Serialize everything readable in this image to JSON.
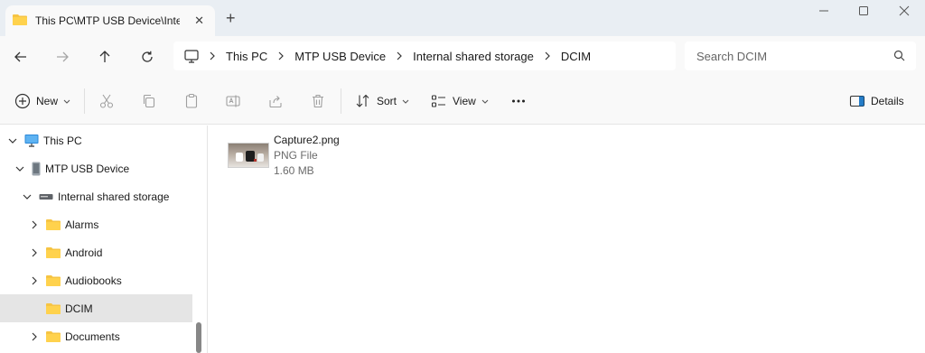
{
  "tab": {
    "title": "This PC\\MTP USB Device\\Internal shared storage\\DCIM"
  },
  "toolbar": {
    "new_label": "New",
    "sort_label": "Sort",
    "view_label": "View",
    "details_label": "Details"
  },
  "address": {
    "crumbs": [
      "This PC",
      "MTP USB Device",
      "Internal shared storage",
      "DCIM"
    ]
  },
  "search": {
    "placeholder": "Search DCIM"
  },
  "sidebar": {
    "items": [
      {
        "label": "This PC",
        "expanded": true,
        "icon": "monitor-icon"
      },
      {
        "label": "MTP USB Device",
        "expanded": true,
        "icon": "phone-icon"
      },
      {
        "label": "Internal shared storage",
        "expanded": true,
        "icon": "drive-icon"
      },
      {
        "label": "Alarms",
        "expanded": false,
        "icon": "folder-icon"
      },
      {
        "label": "Android",
        "expanded": false,
        "icon": "folder-icon"
      },
      {
        "label": "Audiobooks",
        "expanded": false,
        "icon": "folder-icon"
      },
      {
        "label": "DCIM",
        "selected": true,
        "icon": "folder-icon"
      },
      {
        "label": "Documents",
        "expanded": false,
        "icon": "folder-icon"
      }
    ]
  },
  "files": [
    {
      "name": "Capture2.png",
      "type": "PNG File",
      "size": "1.60 MB"
    }
  ],
  "colors": {
    "folder": "#f6c443",
    "accent": "#0067c0",
    "selected_bg": "#e5e5e5"
  }
}
